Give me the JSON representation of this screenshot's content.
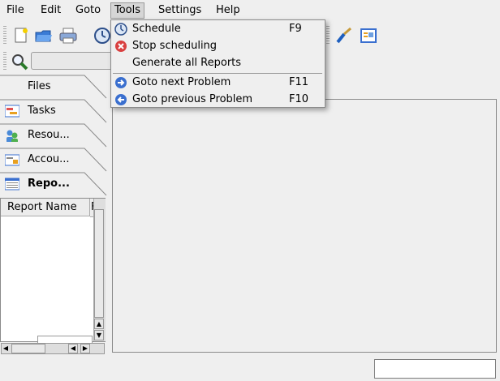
{
  "menubar": {
    "file": "File",
    "edit": "Edit",
    "goto": "Goto",
    "tools": "Tools",
    "settings": "Settings",
    "help": "Help"
  },
  "tools_menu": {
    "items": [
      {
        "label": "Schedule",
        "shortcut": "F9",
        "icon": "clock-icon"
      },
      {
        "label": "Stop scheduling",
        "shortcut": "",
        "icon": "stop-icon"
      },
      {
        "label": "Generate all Reports",
        "shortcut": "",
        "icon": ""
      },
      {
        "label": "Goto next Problem",
        "shortcut": "F11",
        "icon": "arrow-right-icon"
      },
      {
        "label": "Goto previous Problem",
        "shortcut": "F10",
        "icon": "arrow-left-icon"
      }
    ]
  },
  "sidebar": {
    "tabs": [
      {
        "label": "Files",
        "icon": "files-icon"
      },
      {
        "label": "Tasks",
        "icon": "tasks-icon"
      },
      {
        "label": "Resou...",
        "icon": "resources-icon"
      },
      {
        "label": "Accou...",
        "icon": "accounts-icon"
      },
      {
        "label": "Repo...",
        "icon": "reports-icon"
      }
    ],
    "list_header": "Report Name",
    "list_header_2": "F"
  },
  "colors": {
    "menu_bg": "#efefef",
    "accent_blue": "#3a6fcf",
    "stop_red": "#d94040"
  }
}
